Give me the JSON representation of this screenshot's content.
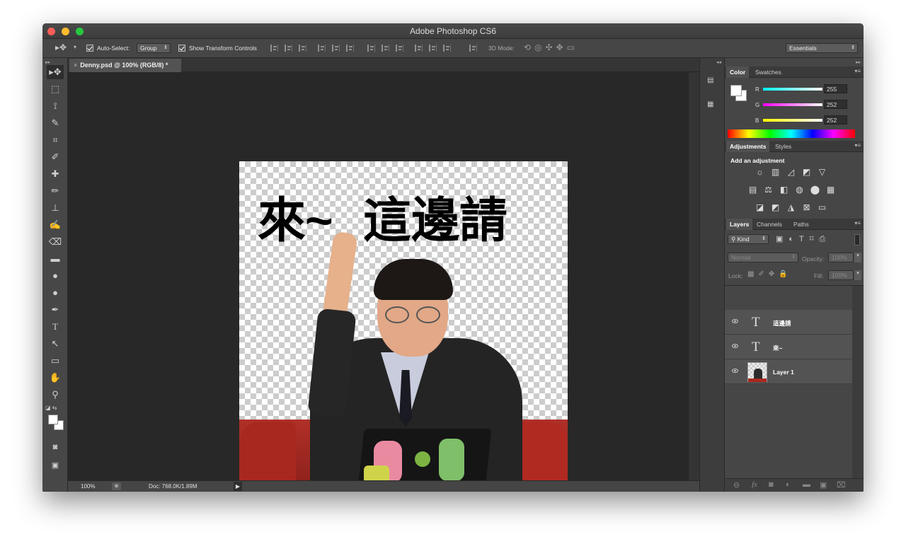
{
  "window": {
    "title": "Adobe Photoshop CS6"
  },
  "options_bar": {
    "auto_select_label": "Auto-Select:",
    "auto_select_value": "Group",
    "show_transform_label": "Show Transform Controls",
    "mode_3d_label": "3D Mode:",
    "workspace": "Essentials"
  },
  "document": {
    "tab_label": "Denny.psd @ 100% (RGB/8) *",
    "text_layer_1": "來~",
    "text_layer_2": "這邊請"
  },
  "status": {
    "zoom": "100%",
    "doc_size": "Doc: 768.0K/1.89M"
  },
  "color_panel": {
    "tabs": [
      "Color",
      "Swatches"
    ],
    "r_label": "R",
    "g_label": "G",
    "b_label": "B",
    "r": "255",
    "g": "252",
    "b": "252"
  },
  "adjustments_panel": {
    "tabs": [
      "Adjustments",
      "Styles"
    ],
    "heading": "Add an adjustment"
  },
  "layers_panel": {
    "tabs": [
      "Layers",
      "Channels",
      "Paths"
    ],
    "filter": "Kind",
    "blend_mode": "Normal",
    "opacity_label": "Opacity:",
    "opacity": "100%",
    "lock_label": "Lock:",
    "fill_label": "Fill:",
    "fill": "100%",
    "layers": [
      {
        "name": "這邊請",
        "type": "text"
      },
      {
        "name": "來~",
        "type": "text"
      },
      {
        "name": "Layer 1",
        "type": "image"
      }
    ]
  },
  "colors": {
    "close": "#fd5f57",
    "minimize": "#fdbc2e",
    "zoom": "#27c840"
  }
}
